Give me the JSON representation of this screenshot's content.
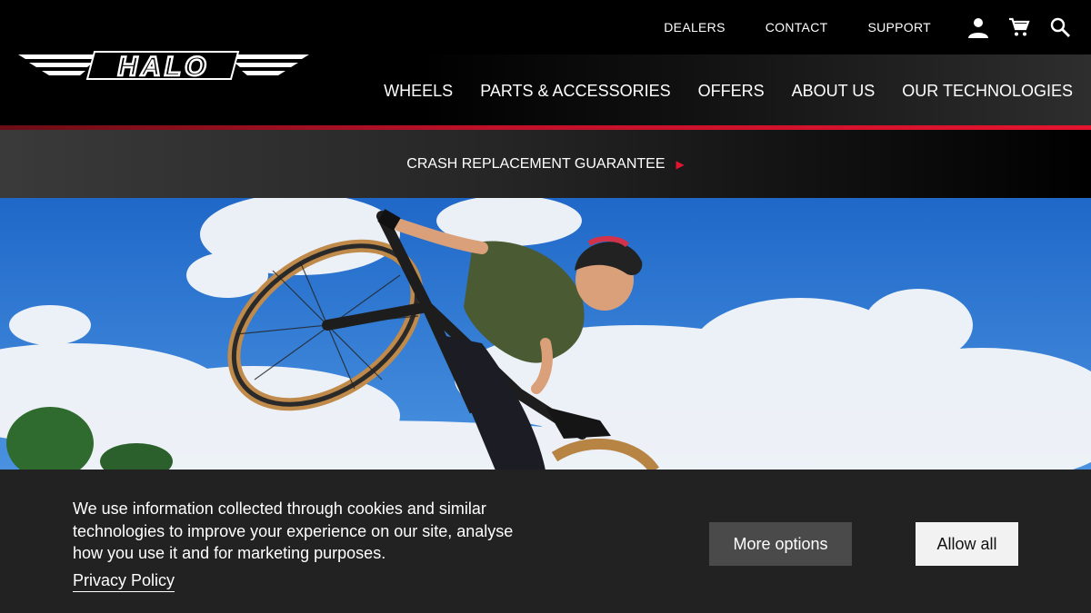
{
  "brand": {
    "logo_text": "HALO"
  },
  "utility_nav": {
    "links": [
      "DEALERS",
      "CONTACT",
      "SUPPORT"
    ],
    "icons": [
      "account-icon",
      "cart-icon",
      "search-icon"
    ]
  },
  "main_nav": {
    "items": [
      "WHEELS",
      "PARTS & ACCESSORIES",
      "OFFERS",
      "ABOUT US",
      "OUR TECHNOLOGIES"
    ]
  },
  "promo": {
    "label": "CRASH REPLACEMENT GUARANTEE"
  },
  "cookie_banner": {
    "message": "We use information collected through cookies and similar technologies to improve your experience on our site, analyse how you use it and for marketing purposes.",
    "policy_link": "Privacy Policy",
    "more_options_label": "More options",
    "allow_all_label": "Allow all"
  },
  "colors": {
    "accent": "#e4142f",
    "header_bg": "#000000",
    "cookie_bg": "#222222",
    "sky": "#2a76d2"
  }
}
